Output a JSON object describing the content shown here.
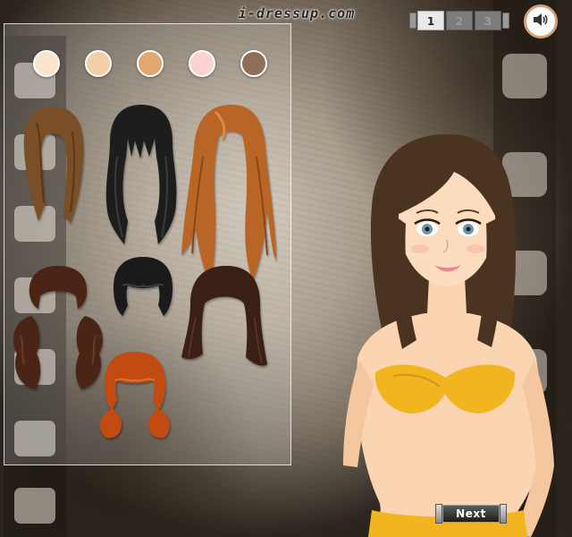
{
  "header": {
    "site_title": "i-dressup.com"
  },
  "pager": {
    "pages": [
      "1",
      "2",
      "3"
    ],
    "active_page": "1"
  },
  "sound": {
    "icon": "speaker-icon"
  },
  "panel": {
    "skin_tones": [
      "#fbe4cc",
      "#f2cfa6",
      "#e1a76e",
      "#fbd2d2",
      "#8e6e57"
    ],
    "hair_options": [
      {
        "name": "short-brown-bob",
        "color": "#7a4e27"
      },
      {
        "name": "long-black-layered",
        "color": "#1d1d1d"
      },
      {
        "name": "long-auburn-straight",
        "color": "#b86526"
      },
      {
        "name": "curly-brown-updo",
        "color": "#4a2515"
      },
      {
        "name": "short-black-bob",
        "color": "#1a1a1a"
      },
      {
        "name": "wavy-dark-brown",
        "color": "#3a1f16"
      },
      {
        "name": "red-pigtails",
        "color": "#c14b10"
      }
    ]
  },
  "model": {
    "hair_color": "#4a3320",
    "top_color": "#f2b51f"
  },
  "footer": {
    "next_label": "Next"
  }
}
